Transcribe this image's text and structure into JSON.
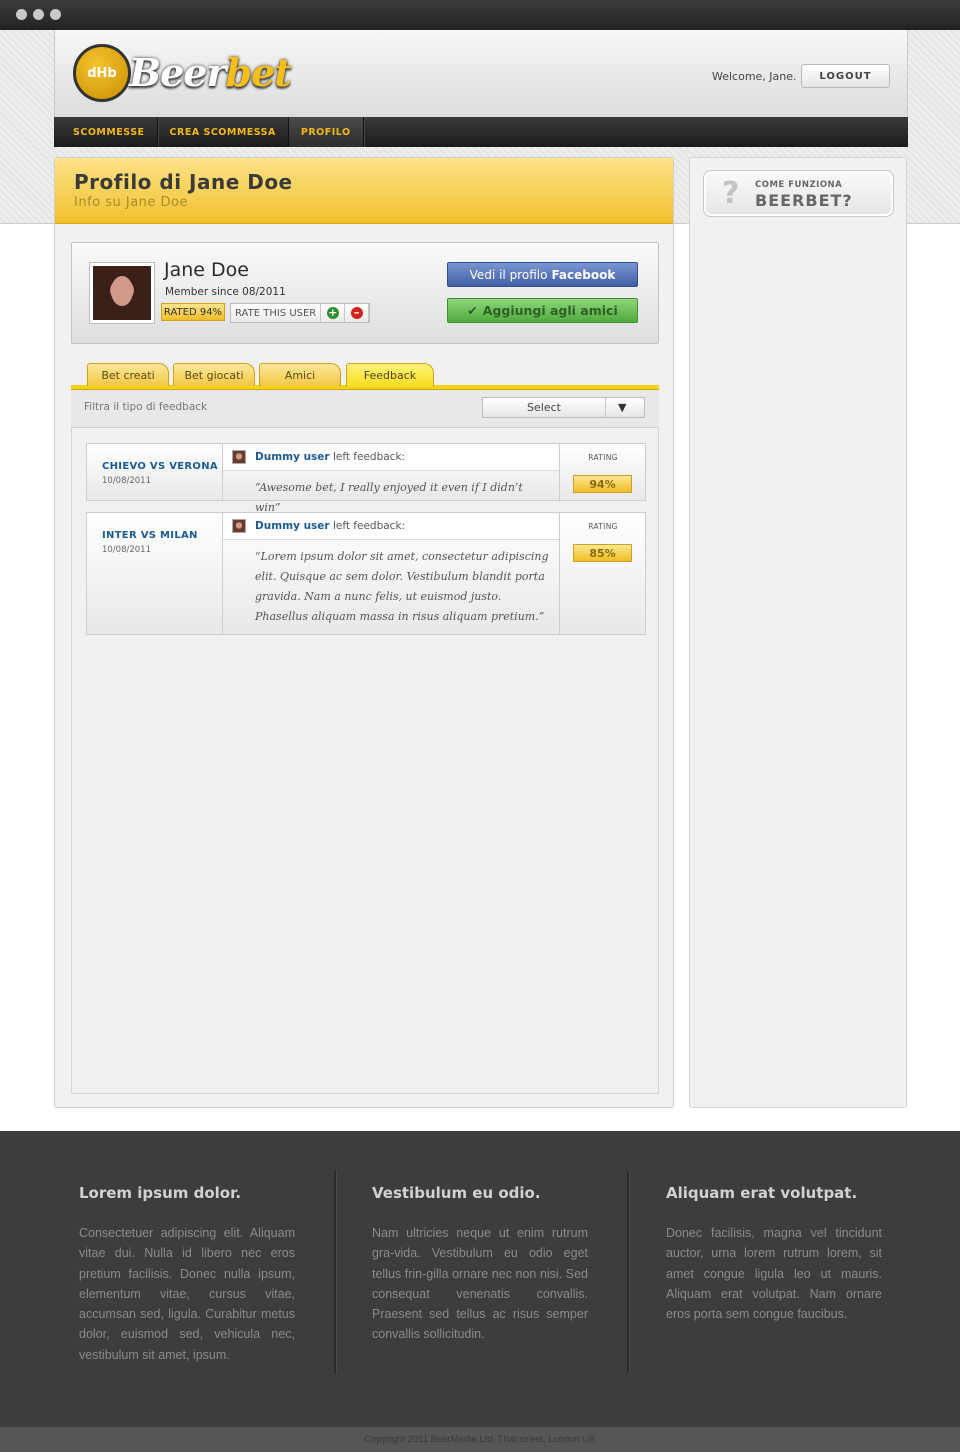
{
  "window": {
    "controls": [
      "close",
      "minimize",
      "maximize"
    ]
  },
  "header": {
    "logo_prefix": "Beer",
    "logo_suffix": "bet",
    "logo_badge": "dHb",
    "welcome": "Welcome, Jane.",
    "logout_label": "LOGOUT"
  },
  "nav": {
    "items": [
      {
        "label": "SCOMMESSE",
        "active": false
      },
      {
        "label": "CREA SCOMMESSA",
        "active": false
      },
      {
        "label": "PROFILO",
        "active": true
      }
    ]
  },
  "page": {
    "title": "Profilo di Jane Doe",
    "subtitle": "Info su Jane Doe"
  },
  "profile": {
    "name": "Jane Doe",
    "member_since": "Member since 08/2011",
    "rated": "RATED 94%",
    "rate_label": "RATE THIS USER",
    "plus_icon": "+",
    "minus_icon": "–",
    "facebook_prefix": "Vedi il profilo",
    "facebook_brand": "Facebook",
    "add_friend": "Aggiungi agli amici"
  },
  "tabs": [
    {
      "label": "Bet creati",
      "active": false
    },
    {
      "label": "Bet giocati",
      "active": false
    },
    {
      "label": "Amici",
      "active": false
    },
    {
      "label": "Feedback",
      "active": true
    }
  ],
  "filter": {
    "label": "Filtra il tipo di feedback",
    "select_value": "Select",
    "arrow": "▼"
  },
  "feedback": [
    {
      "match": "CHIEVO VS VERONA",
      "date": "10/08/2011",
      "author": "Dummy user",
      "action": "left feedback:",
      "quote": "“Awesome bet, I really enjoyed it even if I didn’t win”",
      "rating_label": "RATING",
      "rating": "94%"
    },
    {
      "match": "INTER VS MILAN",
      "date": "10/08/2011",
      "author": "Dummy user",
      "action": "left feedback:",
      "quote": "“Lorem ipsum dolor sit amet, consectetur adipiscing elit. Quisque ac sem dolor. Vestibulum blandit porta gravida. Nam a nunc felis, ut euismod justo. Phasellus aliquam massa in risus aliquam pretium.”",
      "rating_label": "RATING",
      "rating": "85%"
    }
  ],
  "sidebar": {
    "howto_small": "COME FUNZIONA",
    "howto_big": "BEERBET?",
    "icon": "?"
  },
  "footer": {
    "columns": [
      {
        "title": "Lorem ipsum dolor.",
        "text": "Consectetuer adipiscing elit. Aliquam vitae dui. Nulla id libero nec eros pretium facilisis. Donec nulla ipsum, elementum vitae, cursus vitae, accumsan sed, ligula. Curabitur metus dolor, euismod sed, vehicula nec, vestibulum sit amet, ipsum."
      },
      {
        "title": "Vestibulum eu odio.",
        "text": "Nam ultricies neque ut enim rutrum gra-vida. Vestibulum eu odio eget tellus frin-gilla ornare nec non nisi. Sed consequat venenatis convallis. Praesent sed tellus ac risus semper convallis sollicitudin."
      },
      {
        "title": "Aliquam erat volutpat.",
        "text": "Donec facilisis, magna vel tincidunt auctor, urna lorem rutrum lorem, sit amet congue ligula leo ut mauris. Aliquam erat volutpat. Nam ornare eros porta sem congue faucibus."
      }
    ],
    "copyright": "Copyright 2011 BeerMedia Ltd, That street, London UK"
  },
  "colors": {
    "accent_yellow": "#f2c744",
    "nav_text": "#f2b90f",
    "link_blue": "#1a5b94",
    "facebook_blue": "#3f5fa6",
    "friend_green": "#4fab3e",
    "footer_bg": "#3d3d3e"
  }
}
